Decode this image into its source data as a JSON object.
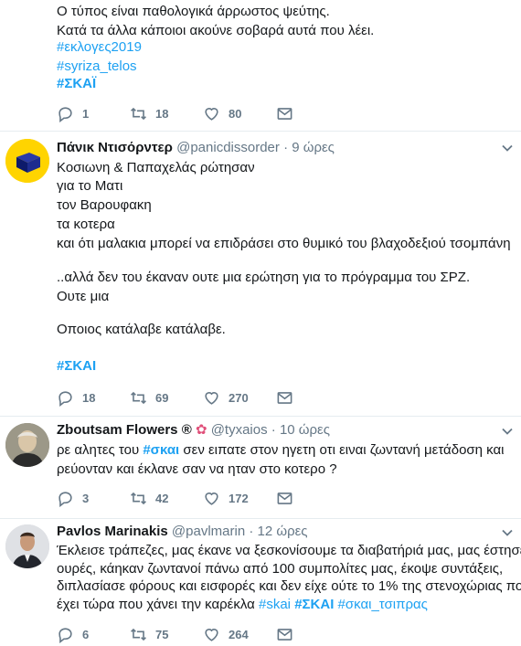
{
  "tweets": [
    {
      "lines": [
        "Ο τύπος είναι παθολογικά άρρωστος ψεύτης.",
        "Κατά τα άλλα κάποιοι ακούνε σοβαρά αυτά που λέει."
      ],
      "hashtags": [
        "#εκλογες2019",
        "#syriza_telos",
        "#ΣΚΑΪ"
      ],
      "replies": "1",
      "retweets": "18",
      "likes": "80"
    },
    {
      "name": "Πάνικ Ντισόρντερ",
      "handle": "@panicdissorder",
      "time": "· 9 ώρες",
      "lines": [
        "Κοσιωνη & Παπαχελάς ρώτησαν",
        "για το Ματι",
        "τον Βαρουφακη",
        "τα κοτερα",
        "και ότι μαλακια μπορεί να επιδράσει στο θυμικό του βλαχοδεξιού τσομπάνη",
        "..αλλά δεν του έκαναν ουτε μια ερώτηση για το πρόγραμμα του ΣΡΖ.",
        "Ουτε μια",
        "Οποιος κατάλαβε κατάλαβε."
      ],
      "hashtags": [
        "#ΣΚΑΙ"
      ],
      "replies": "18",
      "retweets": "69",
      "likes": "270"
    },
    {
      "name": "Zboutsam Flowers",
      "badge": "®",
      "handle": "@tyxaios",
      "time": "· 10 ώρες",
      "line1_pre": "ρε αλητες του ",
      "line1_tag": "#σκαι",
      "line1_post": " σεν ειπατε στον ηγετη οτι ειναι ζωντανή μετάδοση και",
      "line2": "ρεύονταν και έκλανε σαν να ηταν στο κοτερο ?",
      "replies": "3",
      "retweets": "42",
      "likes": "172"
    },
    {
      "name": "Pavlos Marinakis",
      "handle": "@pavlmarin",
      "time": "· 12 ώρες",
      "lines": [
        "Έκλεισε τράπεζες, μας έκανε να ξεσκονίσουμε τα διαβατήριά μας, μας έστησε σε",
        "ουρές, κάηκαν ζωντανοί πάνω από 100 συμπολίτες μας, έκοψε συντάξεις,",
        "διπλασίασε φόρους και εισφορές και δεν είχε ούτε το 1% της στενοχώριας που"
      ],
      "last_pre": "έχει τώρα που χάνει την καρέκλα ",
      "last_tags": [
        "#skai",
        "#ΣΚΑΙ",
        "#σκαι_τσιπρας"
      ],
      "replies": "6",
      "retweets": "75",
      "likes": "264"
    }
  ],
  "icons": {
    "reply": "reply-icon",
    "retweet": "retweet-icon",
    "like": "heart-icon",
    "dm": "envelope-icon",
    "menu": "chevron-down-icon"
  },
  "colors": {
    "link": "#1da1f2",
    "secondary": "#657786",
    "divider": "#e6ecf0"
  }
}
